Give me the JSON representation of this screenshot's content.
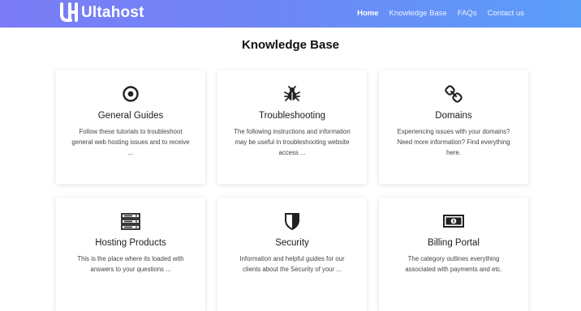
{
  "brand": {
    "name": "Ultahost",
    "color": "#ffffff"
  },
  "nav": [
    {
      "label": "Home",
      "active": true
    },
    {
      "label": "Knowledge Base",
      "active": false
    },
    {
      "label": "FAQs",
      "active": false
    },
    {
      "label": "Contact us",
      "active": false
    }
  ],
  "page_title": "Knowledge Base",
  "cards": [
    {
      "icon": "target-icon",
      "title": "General Guides",
      "description": "Follow these tutorials to troubleshoot general web hosting issues and to receive ..."
    },
    {
      "icon": "bug-icon",
      "title": "Troubleshooting",
      "description": "The following instructions and information may be useful in troubleshooting website access ..."
    },
    {
      "icon": "link-icon",
      "title": "Domains",
      "description": "Experiencing issues with your domains? Need more information? Find everything here."
    },
    {
      "icon": "server-icon",
      "title": "Hosting Products",
      "description": "This is the place where its loaded with answers to your questions ..."
    },
    {
      "icon": "shield-icon",
      "title": "Security",
      "description": "Information and helpful guides for our clients about the Security of your ..."
    },
    {
      "icon": "money-icon",
      "title": "Billing Portal",
      "description": "The category outlines everything associated with payments and etc."
    }
  ],
  "colors": {
    "header_start": "#7b7cf5",
    "header_end": "#5a9ef8",
    "icon": "#222222"
  }
}
